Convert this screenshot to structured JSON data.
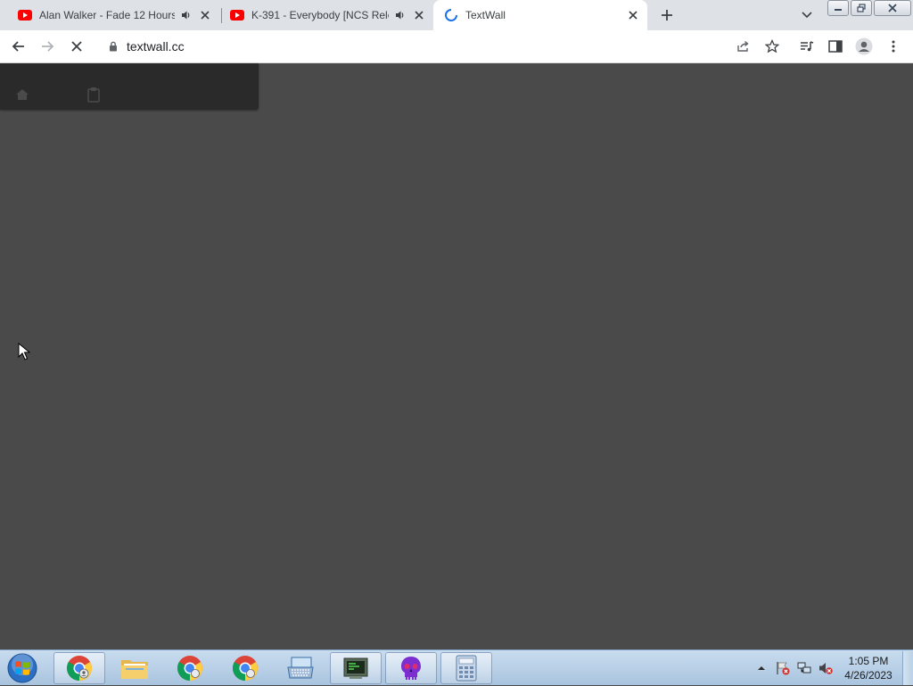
{
  "browser": {
    "tabs": [
      {
        "title": "Alan Walker - Fade 12 Hours",
        "favicon": "youtube-icon",
        "audio": true,
        "active": false
      },
      {
        "title": "K-391 - Everybody [NCS Rele",
        "favicon": "youtube-icon",
        "audio": true,
        "active": false
      },
      {
        "title": "TextWall",
        "favicon": "loading-spinner-icon",
        "audio": false,
        "active": true
      }
    ],
    "url": "textwall.cc",
    "loading": true
  },
  "page": {
    "nav_icons": [
      "home-icon",
      "clipboard-icon"
    ],
    "background": "#4a4a4a",
    "nav_background": "#2a2a2a"
  },
  "taskbar": {
    "items": [
      {
        "name": "chrome-icon",
        "running": true
      },
      {
        "name": "file-explorer-icon",
        "running": false
      },
      {
        "name": "chrome-icon",
        "running": false
      },
      {
        "name": "chrome-icon",
        "running": false
      },
      {
        "name": "on-screen-keyboard-icon",
        "running": false
      },
      {
        "name": "terminal-icon",
        "running": true
      },
      {
        "name": "skull-icon",
        "running": true
      },
      {
        "name": "calculator-icon",
        "running": true
      }
    ],
    "clock": {
      "time": "1:05 PM",
      "date": "4/26/2023"
    }
  },
  "colors": {
    "youtube_red": "#ff0000",
    "chrome_blue": "#1a73e8",
    "tabstrip": "#dee1e6"
  }
}
